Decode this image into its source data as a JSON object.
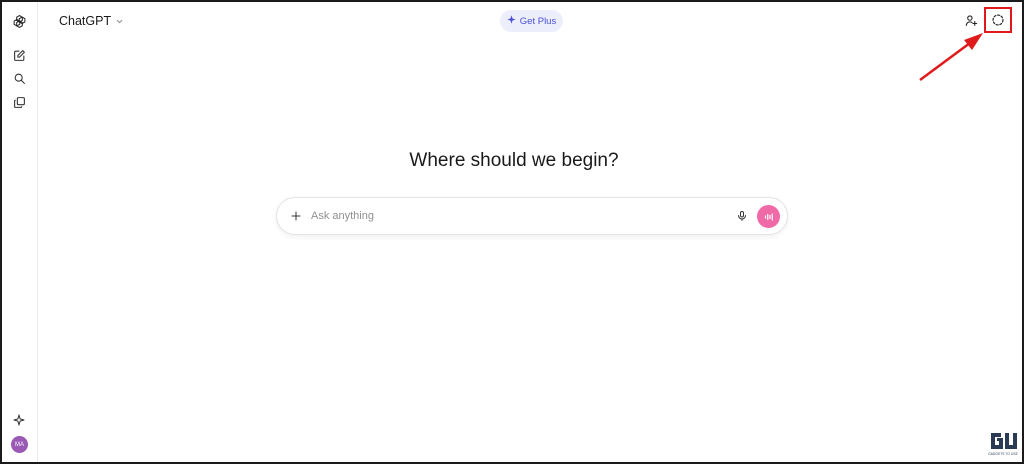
{
  "app": {
    "name": "ChatGPT"
  },
  "sidebar": {
    "items": [
      {
        "icon": "openai-logo-icon"
      },
      {
        "icon": "new-chat-icon"
      },
      {
        "icon": "search-icon"
      },
      {
        "icon": "library-icon"
      }
    ],
    "bottom": [
      {
        "icon": "sparkle-icon"
      }
    ],
    "avatar_initials": "MA"
  },
  "header": {
    "model_label": "ChatGPT",
    "get_plus_label": "Get Plus",
    "right_icons": [
      "add-person-icon",
      "temporary-chat-icon"
    ]
  },
  "main": {
    "heading": "Where should we begin?",
    "composer": {
      "placeholder": "Ask anything"
    }
  },
  "annotation": {
    "color": "#e01a1a"
  },
  "watermark": {
    "text": "GADGETS TO USE"
  },
  "colors": {
    "accent": "#4a4fd6",
    "get_plus_bg": "#eceefb",
    "voice_button": "#f06aa8",
    "avatar": "#9b59b6"
  }
}
